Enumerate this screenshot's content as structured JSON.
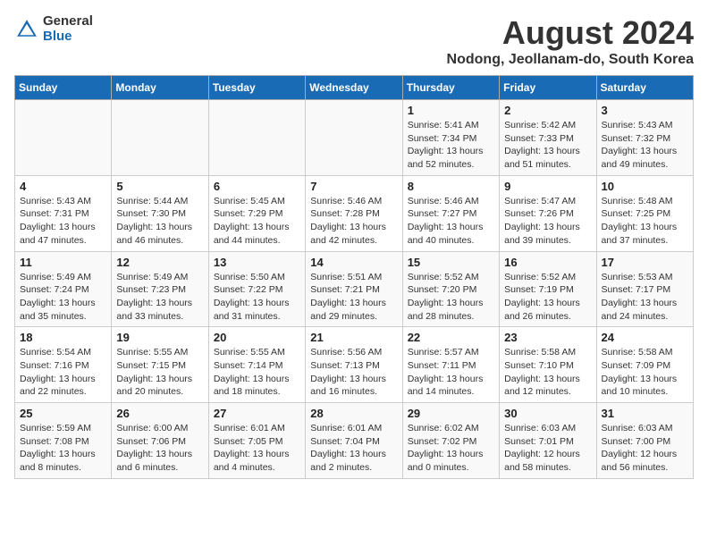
{
  "header": {
    "logo_general": "General",
    "logo_blue": "Blue",
    "title": "August 2024",
    "subtitle": "Nodong, Jeollanam-do, South Korea"
  },
  "days_of_week": [
    "Sunday",
    "Monday",
    "Tuesday",
    "Wednesday",
    "Thursday",
    "Friday",
    "Saturday"
  ],
  "weeks": [
    [
      {
        "day": "",
        "info": ""
      },
      {
        "day": "",
        "info": ""
      },
      {
        "day": "",
        "info": ""
      },
      {
        "day": "",
        "info": ""
      },
      {
        "day": "1",
        "info": "Sunrise: 5:41 AM\nSunset: 7:34 PM\nDaylight: 13 hours\nand 52 minutes."
      },
      {
        "day": "2",
        "info": "Sunrise: 5:42 AM\nSunset: 7:33 PM\nDaylight: 13 hours\nand 51 minutes."
      },
      {
        "day": "3",
        "info": "Sunrise: 5:43 AM\nSunset: 7:32 PM\nDaylight: 13 hours\nand 49 minutes."
      }
    ],
    [
      {
        "day": "4",
        "info": "Sunrise: 5:43 AM\nSunset: 7:31 PM\nDaylight: 13 hours\nand 47 minutes."
      },
      {
        "day": "5",
        "info": "Sunrise: 5:44 AM\nSunset: 7:30 PM\nDaylight: 13 hours\nand 46 minutes."
      },
      {
        "day": "6",
        "info": "Sunrise: 5:45 AM\nSunset: 7:29 PM\nDaylight: 13 hours\nand 44 minutes."
      },
      {
        "day": "7",
        "info": "Sunrise: 5:46 AM\nSunset: 7:28 PM\nDaylight: 13 hours\nand 42 minutes."
      },
      {
        "day": "8",
        "info": "Sunrise: 5:46 AM\nSunset: 7:27 PM\nDaylight: 13 hours\nand 40 minutes."
      },
      {
        "day": "9",
        "info": "Sunrise: 5:47 AM\nSunset: 7:26 PM\nDaylight: 13 hours\nand 39 minutes."
      },
      {
        "day": "10",
        "info": "Sunrise: 5:48 AM\nSunset: 7:25 PM\nDaylight: 13 hours\nand 37 minutes."
      }
    ],
    [
      {
        "day": "11",
        "info": "Sunrise: 5:49 AM\nSunset: 7:24 PM\nDaylight: 13 hours\nand 35 minutes."
      },
      {
        "day": "12",
        "info": "Sunrise: 5:49 AM\nSunset: 7:23 PM\nDaylight: 13 hours\nand 33 minutes."
      },
      {
        "day": "13",
        "info": "Sunrise: 5:50 AM\nSunset: 7:22 PM\nDaylight: 13 hours\nand 31 minutes."
      },
      {
        "day": "14",
        "info": "Sunrise: 5:51 AM\nSunset: 7:21 PM\nDaylight: 13 hours\nand 29 minutes."
      },
      {
        "day": "15",
        "info": "Sunrise: 5:52 AM\nSunset: 7:20 PM\nDaylight: 13 hours\nand 28 minutes."
      },
      {
        "day": "16",
        "info": "Sunrise: 5:52 AM\nSunset: 7:19 PM\nDaylight: 13 hours\nand 26 minutes."
      },
      {
        "day": "17",
        "info": "Sunrise: 5:53 AM\nSunset: 7:17 PM\nDaylight: 13 hours\nand 24 minutes."
      }
    ],
    [
      {
        "day": "18",
        "info": "Sunrise: 5:54 AM\nSunset: 7:16 PM\nDaylight: 13 hours\nand 22 minutes."
      },
      {
        "day": "19",
        "info": "Sunrise: 5:55 AM\nSunset: 7:15 PM\nDaylight: 13 hours\nand 20 minutes."
      },
      {
        "day": "20",
        "info": "Sunrise: 5:55 AM\nSunset: 7:14 PM\nDaylight: 13 hours\nand 18 minutes."
      },
      {
        "day": "21",
        "info": "Sunrise: 5:56 AM\nSunset: 7:13 PM\nDaylight: 13 hours\nand 16 minutes."
      },
      {
        "day": "22",
        "info": "Sunrise: 5:57 AM\nSunset: 7:11 PM\nDaylight: 13 hours\nand 14 minutes."
      },
      {
        "day": "23",
        "info": "Sunrise: 5:58 AM\nSunset: 7:10 PM\nDaylight: 13 hours\nand 12 minutes."
      },
      {
        "day": "24",
        "info": "Sunrise: 5:58 AM\nSunset: 7:09 PM\nDaylight: 13 hours\nand 10 minutes."
      }
    ],
    [
      {
        "day": "25",
        "info": "Sunrise: 5:59 AM\nSunset: 7:08 PM\nDaylight: 13 hours\nand 8 minutes."
      },
      {
        "day": "26",
        "info": "Sunrise: 6:00 AM\nSunset: 7:06 PM\nDaylight: 13 hours\nand 6 minutes."
      },
      {
        "day": "27",
        "info": "Sunrise: 6:01 AM\nSunset: 7:05 PM\nDaylight: 13 hours\nand 4 minutes."
      },
      {
        "day": "28",
        "info": "Sunrise: 6:01 AM\nSunset: 7:04 PM\nDaylight: 13 hours\nand 2 minutes."
      },
      {
        "day": "29",
        "info": "Sunrise: 6:02 AM\nSunset: 7:02 PM\nDaylight: 13 hours\nand 0 minutes."
      },
      {
        "day": "30",
        "info": "Sunrise: 6:03 AM\nSunset: 7:01 PM\nDaylight: 12 hours\nand 58 minutes."
      },
      {
        "day": "31",
        "info": "Sunrise: 6:03 AM\nSunset: 7:00 PM\nDaylight: 12 hours\nand 56 minutes."
      }
    ]
  ]
}
